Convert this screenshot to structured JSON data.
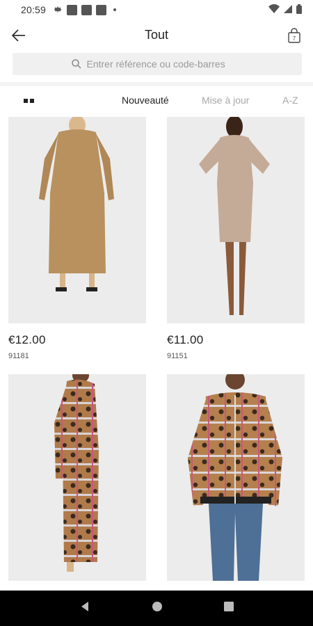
{
  "status_bar": {
    "time": "20:59"
  },
  "header": {
    "title": "Tout",
    "cart_count": "7"
  },
  "search": {
    "placeholder": "Entrer référence ou code-barres"
  },
  "sort": {
    "tabs": [
      {
        "label": "Nouveauté",
        "active": true
      },
      {
        "label": "Mise à jour",
        "active": false
      },
      {
        "label": "A-Z",
        "active": false
      }
    ]
  },
  "products": [
    {
      "price": "€12.00",
      "ref": "91181",
      "image": "camel-maxi-dress"
    },
    {
      "price": "€11.00",
      "ref": "91151",
      "image": "beige-knit-dress"
    },
    {
      "price": "",
      "ref": "",
      "image": "leopard-scarf-print-wrap-dress"
    },
    {
      "price": "",
      "ref": "",
      "image": "leopard-scarf-print-bomber-jacket"
    }
  ],
  "colors": {
    "accent": "#222222",
    "muted": "#a8a8a8",
    "search_bg": "#f0f0f0",
    "navbar": "#000000"
  }
}
